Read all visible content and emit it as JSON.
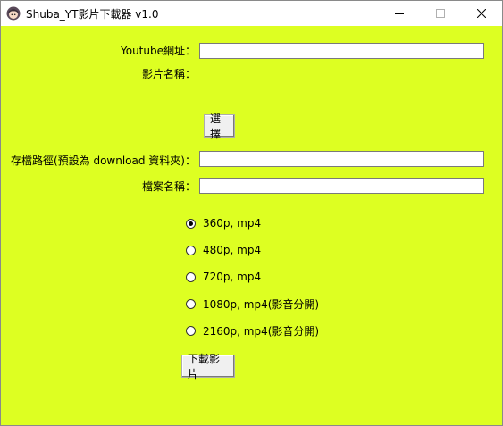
{
  "window": {
    "title": "Shuba_YT影片下載器 v1.0",
    "icon": "anime-avatar-icon"
  },
  "form": {
    "url_label": "Youtube網址：",
    "url_value": "",
    "video_name_label": "影片名稱：",
    "video_name_value": "",
    "select_button": "選擇",
    "save_path_label": "存檔路徑(預設為 download 資料夾)：",
    "save_path_value": "",
    "file_name_label": "檔案名稱：",
    "file_name_value": ""
  },
  "quality": {
    "options": [
      {
        "label": "360p, mp4",
        "selected": true
      },
      {
        "label": "480p, mp4",
        "selected": false
      },
      {
        "label": "720p, mp4",
        "selected": false
      },
      {
        "label": "1080p, mp4(影音分開)",
        "selected": false
      },
      {
        "label": "2160p, mp4(影音分開)",
        "selected": false
      }
    ]
  },
  "actions": {
    "download_button": "下載影片"
  },
  "colors": {
    "background": "#ddff22",
    "titlebar": "#ffffff"
  }
}
